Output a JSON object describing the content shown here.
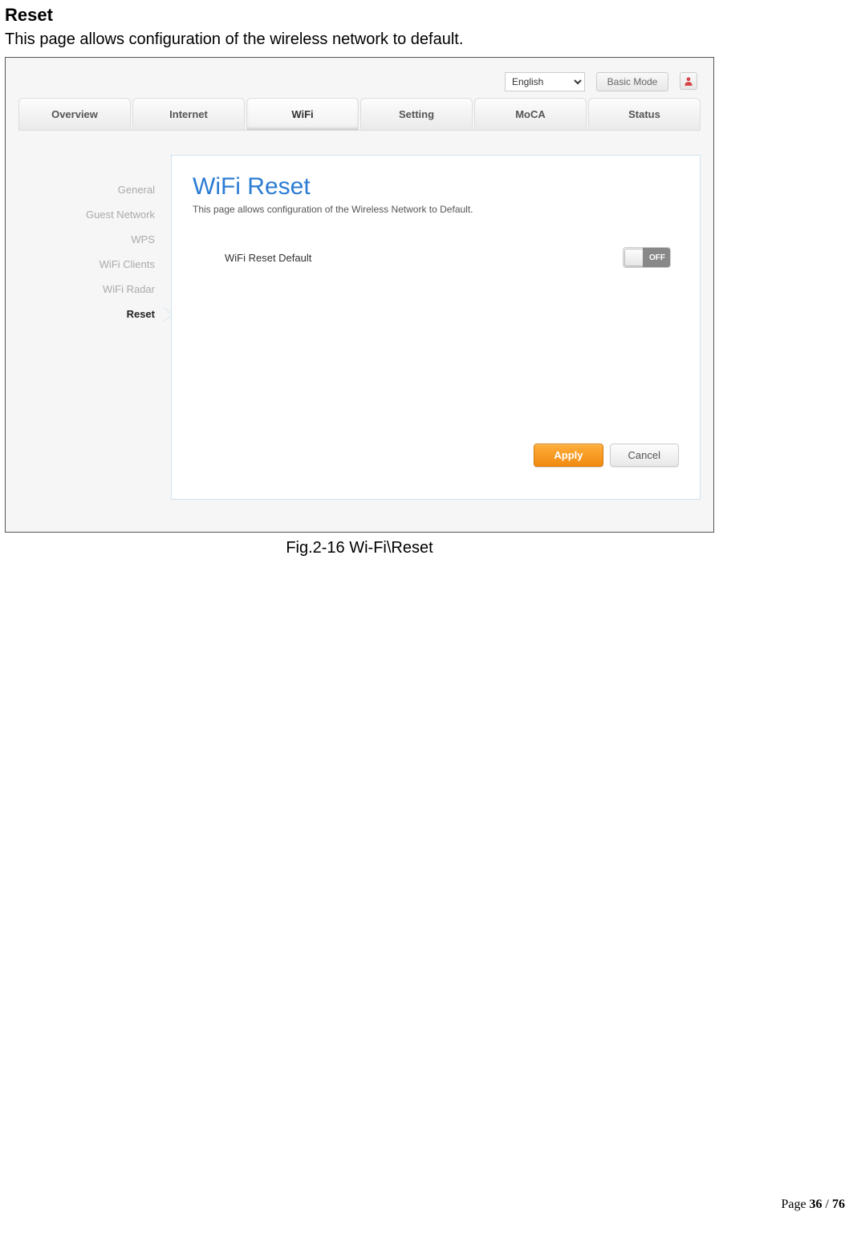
{
  "doc": {
    "heading": "Reset",
    "subtitle": "This page allows configuration of the wireless network to default.",
    "figure_caption": "Fig.2-16 Wi-Fi\\Reset",
    "page_label": "Page ",
    "page_current": "36",
    "page_sep": " / ",
    "page_total": "76"
  },
  "topbar": {
    "language": "English",
    "basic_mode": "Basic Mode"
  },
  "tabs": [
    {
      "label": "Overview",
      "active": false
    },
    {
      "label": "Internet",
      "active": false
    },
    {
      "label": "WiFi",
      "active": true
    },
    {
      "label": "Setting",
      "active": false
    },
    {
      "label": "MoCA",
      "active": false
    },
    {
      "label": "Status",
      "active": false
    }
  ],
  "sidebar": [
    {
      "label": "General",
      "active": false
    },
    {
      "label": "Guest Network",
      "active": false
    },
    {
      "label": "WPS",
      "active": false
    },
    {
      "label": "WiFi Clients",
      "active": false
    },
    {
      "label": "WiFi Radar",
      "active": false
    },
    {
      "label": "Reset",
      "active": true
    }
  ],
  "panel": {
    "title": "WiFi Reset",
    "desc": "This page allows configuration of the Wireless Network to Default.",
    "field_label": "WiFi Reset Default",
    "toggle_state": "OFF"
  },
  "buttons": {
    "apply": "Apply",
    "cancel": "Cancel"
  }
}
